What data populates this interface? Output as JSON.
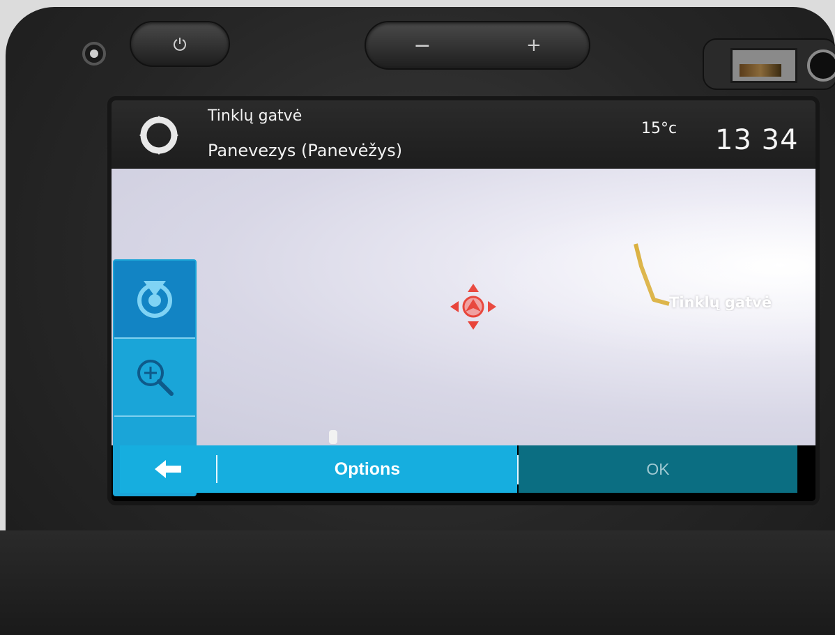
{
  "header": {
    "street_name": "Tinklų gatvė",
    "city_name": "Panevezys (Panevėžys)",
    "temperature": "15°c",
    "time": "13 34"
  },
  "map": {
    "road_label": "Tinklų gatvė"
  },
  "side_panel": {
    "buttons": [
      {
        "icon": "recenter-icon"
      },
      {
        "icon": "zoom-in-icon"
      },
      {
        "icon": "zoom-out-icon"
      }
    ]
  },
  "bottom_bar": {
    "back_icon": "back-arrow-icon",
    "options_label": "Options",
    "ok_label": "OK"
  },
  "hardware": {
    "volume_minus": "−",
    "volume_plus": "+"
  },
  "colors": {
    "accent": "#16aedf",
    "ok_disabled": "#0b6e82",
    "road": "#d4a21c",
    "cursor": "#e8443a"
  }
}
